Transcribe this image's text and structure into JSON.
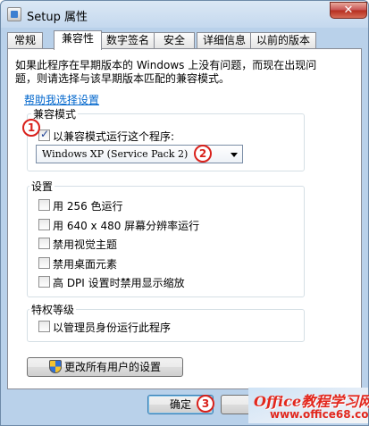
{
  "window": {
    "title": "Setup 属性",
    "close_glyph": "✕"
  },
  "tabs": [
    {
      "label": "常规"
    },
    {
      "label": "兼容性"
    },
    {
      "label": "数字签名"
    },
    {
      "label": "安全"
    },
    {
      "label": "详细信息"
    },
    {
      "label": "以前的版本"
    }
  ],
  "description": "如果此程序在早期版本的 Windows 上没有问题，而现在出现问题，则请选择与该早期版本匹配的兼容模式。",
  "help_link": "帮助我选择设置",
  "compat_mode": {
    "label": "兼容模式",
    "checkbox_label": "以兼容模式运行这个程序:",
    "checked": true,
    "select_value": "Windows XP (Service Pack 2)"
  },
  "settings": {
    "label": "设置",
    "items": [
      {
        "label": "用 256 色运行"
      },
      {
        "label": "用 640 x 480 屏幕分辨率运行"
      },
      {
        "label": "禁用视觉主题"
      },
      {
        "label": "禁用桌面元素"
      },
      {
        "label": "高 DPI 设置时禁用显示缩放"
      }
    ]
  },
  "privilege": {
    "label": "特权等级",
    "checkbox_label": "以管理员身份运行此程序"
  },
  "change_all_button": "更改所有用户的设置",
  "ok_button": "确定",
  "markers": [
    "1",
    "2",
    "3"
  ],
  "watermark": {
    "main": "Office教程学习网",
    "url": "www.office68.com"
  }
}
